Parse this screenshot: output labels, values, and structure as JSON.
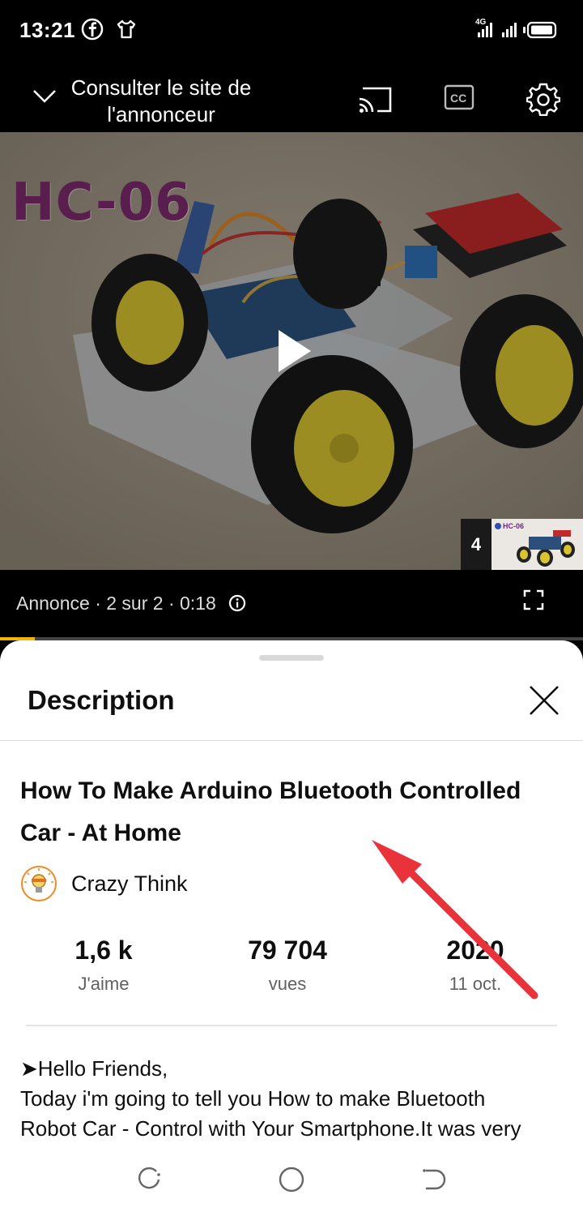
{
  "status_bar": {
    "time": "13:21",
    "network": "4G",
    "icons": [
      "facebook-icon",
      "shirt-icon",
      "signal-icon",
      "battery-icon"
    ]
  },
  "ad_bar": {
    "advertiser_link": "Consulter le site de l'annonceur",
    "icons": [
      "chevron-down-icon",
      "cast-icon",
      "captions-icon",
      "gear-icon"
    ]
  },
  "video": {
    "overlay_text": "HC-06",
    "thumb_overlay_text": "HC-06",
    "queue_count": "4"
  },
  "ad_info": {
    "text": "Annonce · 2 sur 2 · 0:18",
    "progress": 0.06
  },
  "panel": {
    "title": "Description",
    "video_title": "How To Make Arduino Bluetooth Controlled Car - At Home",
    "channel": "Crazy Think",
    "stats": [
      {
        "value": "1,6 k",
        "label": "J'aime"
      },
      {
        "value": "79 704",
        "label": "vues"
      },
      {
        "value": "2020",
        "label": "11 oct."
      }
    ],
    "description_lines": [
      "➤Hello Friends,",
      "Today i'm going to tell you How to make Bluetooth",
      "Robot Car - Control with Your Smartphone.It was very"
    ]
  },
  "colors": {
    "accent_progress": "#f2b705",
    "annotation_arrow": "#e8333a"
  }
}
